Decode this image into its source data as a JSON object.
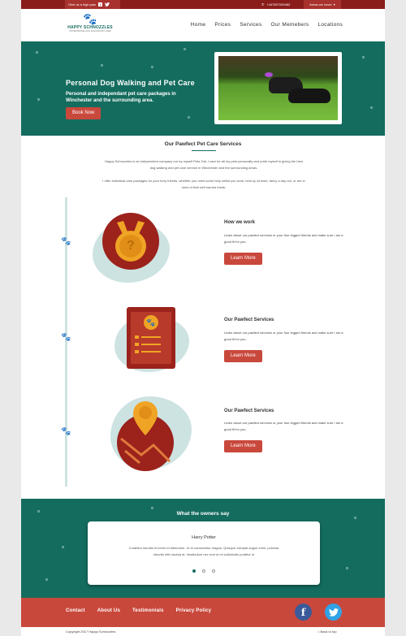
{
  "topbar": {
    "facebook_text": "Give us a high paw",
    "phone": "+447807265482",
    "areas_label": "Areas we cover"
  },
  "header": {
    "logo_name": "HAPPY SCHNOZZLES",
    "logo_tagline": "PROFESSIONAL DOG WALKING/PET CARE",
    "nav": [
      "Home",
      "Prices",
      "Services",
      "Our Memebers",
      "Locations"
    ]
  },
  "hero": {
    "title": "Personal Dog Walking and Pet Care",
    "subtitle": "Personal and independant pet care packages in Winchester and the surrounding area.",
    "button": "Book Now"
  },
  "services": {
    "title": "Our Pawfect Pet Care Services",
    "intro1": "Happy Schnozzles is an independent company run by myself Peta Tait. I care for all my pets personally and pride myself in giving the best dog walking and pet care service in Winchester and the surrounding areas.",
    "intro2": "I offer individual care packages for your furry friends, whether you need some help whilst you work, held up at work, fancy a day out, or are in need of that well earned break.",
    "items": [
      {
        "title": "How we work",
        "text": "Learn about our pawfect services or your four legged friends and make sure I am a good fit for you.",
        "button": "Learn More"
      },
      {
        "title": "Our Pawfect Services",
        "text": "Learn about our pawfect services or your four legged friends and make sure I am a good fit for you.",
        "button": "Learn More"
      },
      {
        "title": "Our Pawfect Services",
        "text": "Learn about our pawfect services or your four legged friends and make sure I am a good fit for you.",
        "button": "Learn More"
      }
    ]
  },
  "testimonials": {
    "title": "What the owners say",
    "name": "Harry Potter",
    "quote": "Curabitur lobortis id lorem id bibendum. Ut id consectetur magna. Quisque volutpat augue enim, pulvinar lobortis nibh lacinia at. Vestibulum nec erat ut mi sollicitudin porttitor id",
    "active_slide": 1,
    "slides": 3
  },
  "footer": {
    "links": [
      "Contact",
      "About Us",
      "Testimonials",
      "Privacy Policy"
    ],
    "facebook_glyph": "f",
    "copyright": "Copyright 2017 Happy Schnozzles",
    "back_to_top": "Back to top"
  },
  "colors": {
    "teal": "#146c5e",
    "dark_red": "#8a1d1a",
    "accent_red": "#c9483c",
    "facebook": "#3b5a99",
    "twitter": "#2fa3e6"
  }
}
